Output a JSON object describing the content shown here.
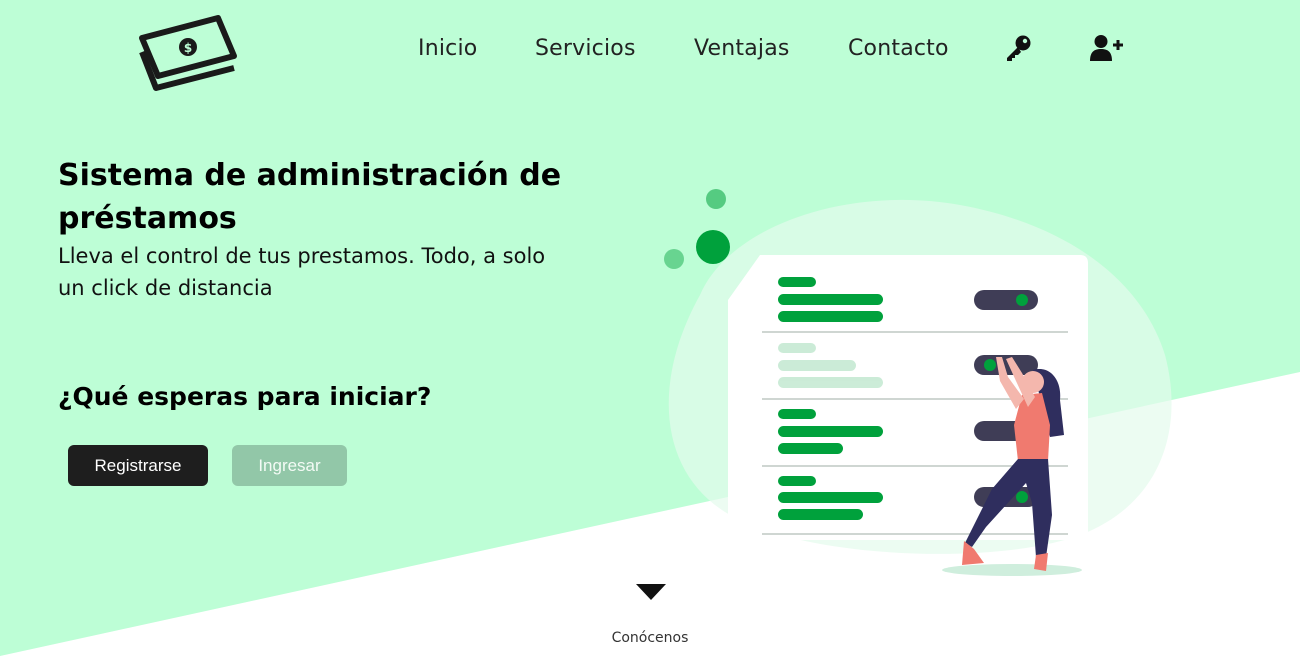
{
  "colors": {
    "background_mint": "#bdfed6",
    "accent_green": "#00a13c",
    "dark": "#1e1e1e",
    "muted_green_button": "#92c7a8",
    "figure_coral": "#f07a6f",
    "figure_navy": "#2f2e5e"
  },
  "header": {
    "logo_icon": "money-bills-icon",
    "nav": [
      {
        "label": "Inicio"
      },
      {
        "label": "Servicios"
      },
      {
        "label": "Ventajas"
      },
      {
        "label": "Contacto"
      }
    ],
    "icons": [
      "key-icon",
      "user-plus-icon"
    ]
  },
  "hero": {
    "title": "Sistema de administración de préstamos",
    "subtitle": "Lleva el control de tus prestamos. Todo, a solo un click de distancia",
    "cta_title": "¿Qué esperas para iniciar?",
    "register_label": "Registrarse",
    "login_label": "Ingresar"
  },
  "footer": {
    "arrow_icon": "triangle-down-icon",
    "know_us": "Conócenos"
  }
}
